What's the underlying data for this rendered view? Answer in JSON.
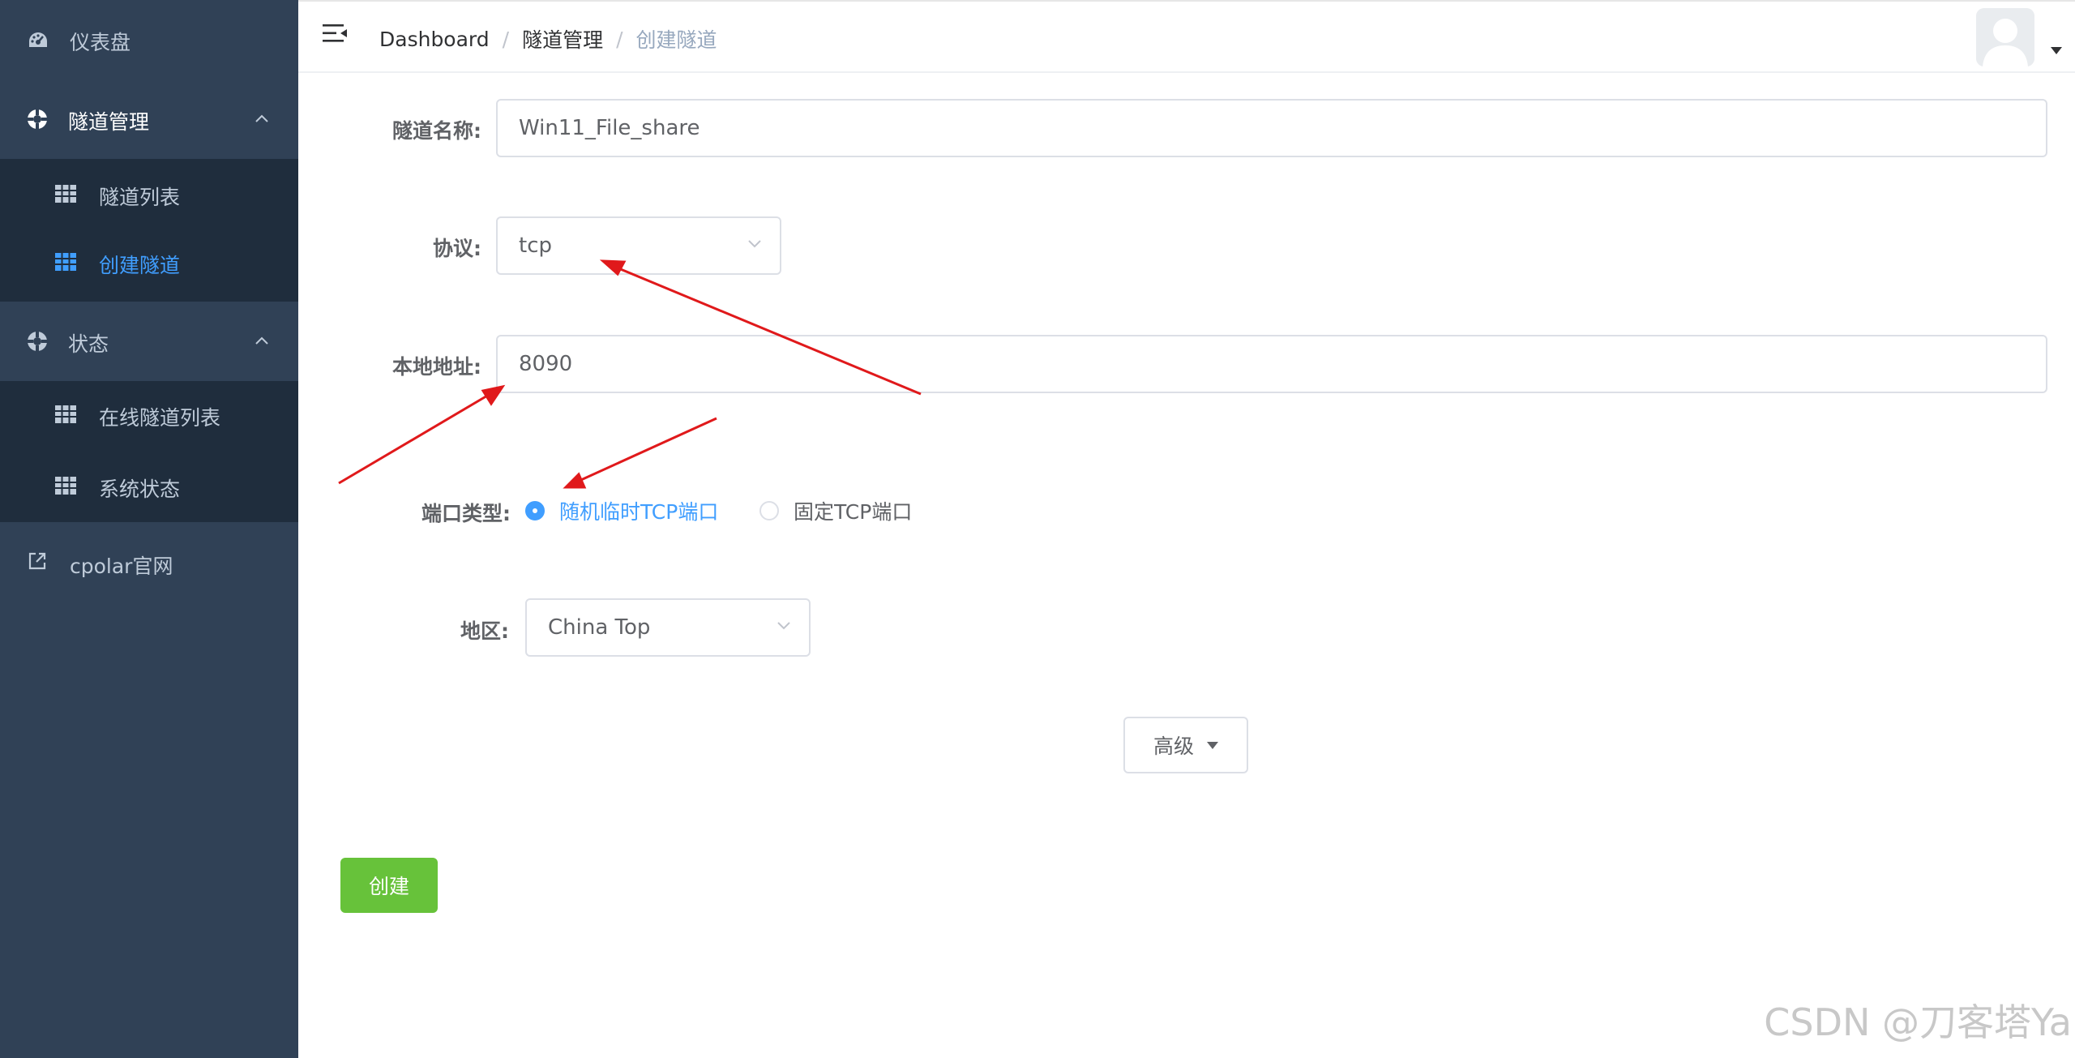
{
  "sidebar": {
    "dashboard": {
      "label": "仪表盘",
      "icon": "dashboard-icon"
    },
    "tunnel_mgmt": {
      "label": "隧道管理",
      "icon": "life-ring-icon",
      "items": [
        {
          "label": "隧道列表",
          "icon": "table-icon"
        },
        {
          "label": "创建隧道",
          "icon": "table-icon",
          "active": true
        }
      ]
    },
    "status": {
      "label": "状态",
      "icon": "life-ring-icon",
      "items": [
        {
          "label": "在线隧道列表",
          "icon": "table-icon"
        },
        {
          "label": "系统状态",
          "icon": "table-icon"
        }
      ]
    },
    "official": {
      "label": "cpolar官网",
      "icon": "external-link-icon"
    }
  },
  "header": {
    "breadcrumb": [
      "Dashboard",
      "隧道管理",
      "创建隧道"
    ]
  },
  "form": {
    "name": {
      "label": "隧道名称:",
      "value": "Win11_File_share"
    },
    "protocol": {
      "label": "协议:",
      "value": "tcp"
    },
    "local_addr": {
      "label": "本地地址:",
      "value": "8090"
    },
    "port_type": {
      "label": "端口类型:",
      "options": [
        "随机临时TCP端口",
        "固定TCP端口"
      ],
      "selected": "随机临时TCP端口"
    },
    "region": {
      "label": "地区:",
      "value": "China Top"
    },
    "advanced_label": "高级",
    "create_label": "创建"
  },
  "watermark": "CSDN @刀客塔Ya",
  "colors": {
    "sidebar_bg": "#304156",
    "submenu_bg": "#1f2d3d",
    "accent": "#409eff",
    "success": "#67c23a",
    "annotation": "#e0191b"
  }
}
